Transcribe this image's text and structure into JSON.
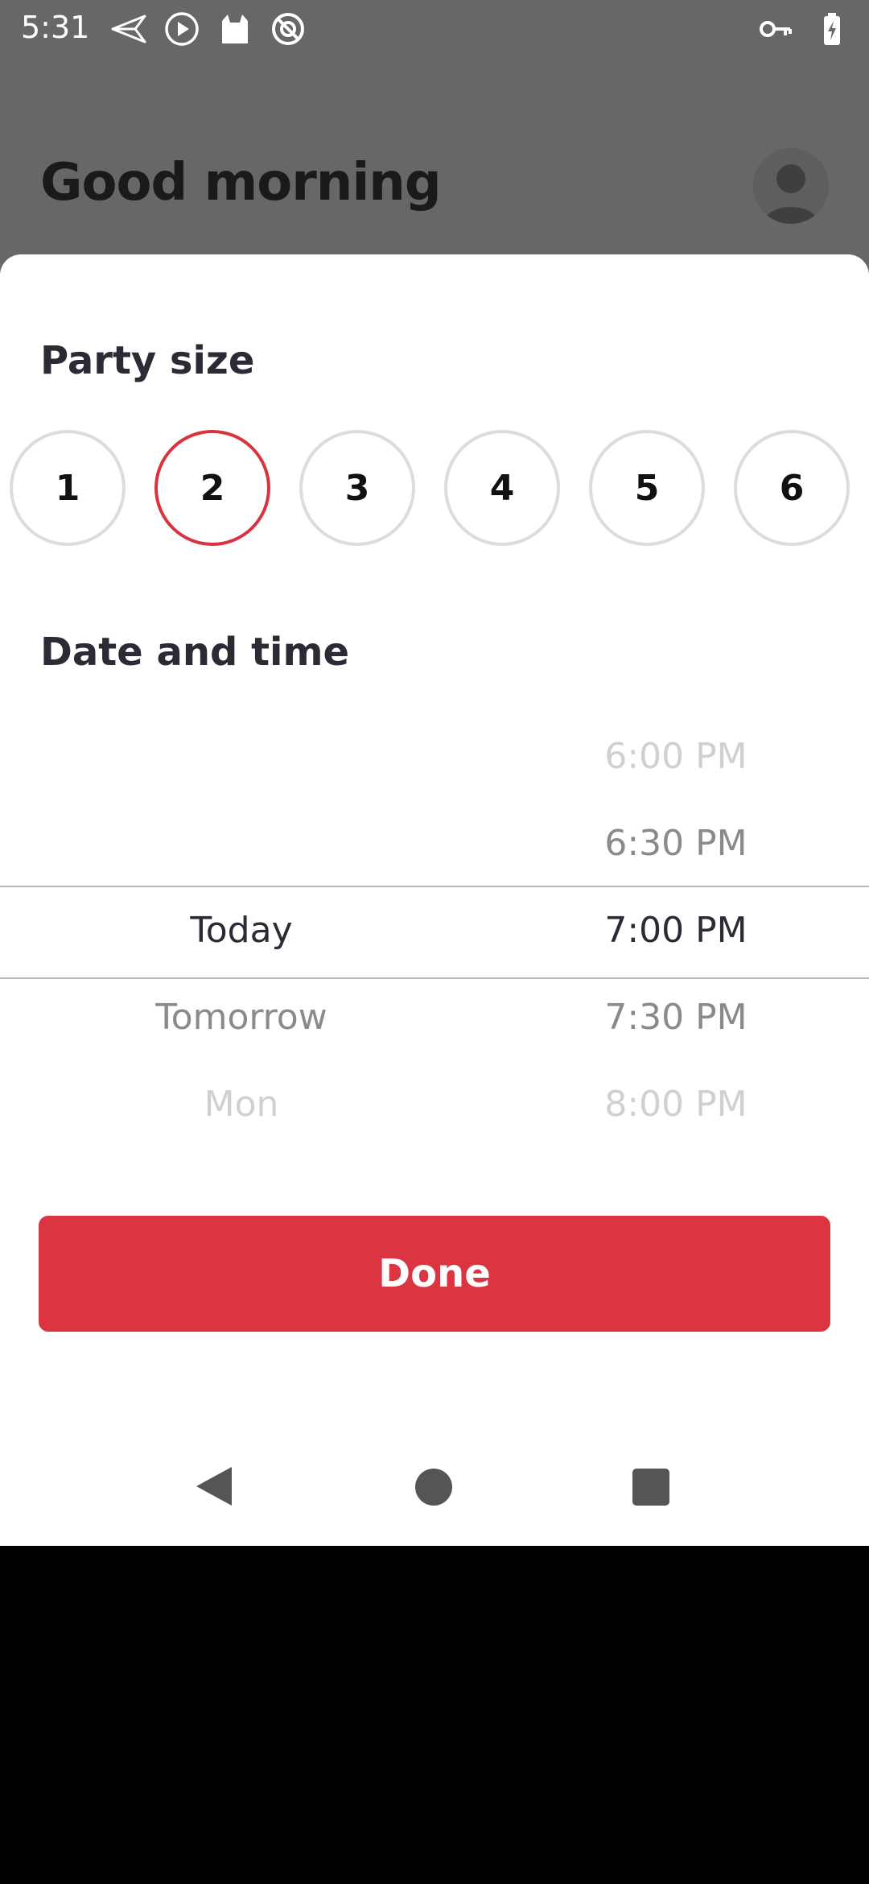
{
  "status_bar": {
    "time": "5:31",
    "left_icons": [
      "send-icon",
      "play-icon",
      "cat-icon",
      "no-circle-icon"
    ],
    "right_icons": [
      "key-icon",
      "battery-charging-icon"
    ]
  },
  "background_app": {
    "greeting": "Good morning",
    "avatar_icon": "person-icon"
  },
  "sheet": {
    "party_size": {
      "title": "Party size",
      "options": [
        "1",
        "2",
        "3",
        "4",
        "5",
        "6"
      ],
      "selected": "2"
    },
    "date_time": {
      "title": "Date and time",
      "dates": [
        "Today",
        "Tomorrow",
        "Mon"
      ],
      "times": [
        "6:00 PM",
        "6:30 PM",
        "7:00 PM",
        "7:30 PM",
        "8:00 PM"
      ],
      "selected_date": "Today",
      "selected_time": "7:00 PM"
    },
    "done_label": "Done"
  },
  "colors": {
    "accent": "#da3541",
    "selected_ring": "#d8343f",
    "text_primary": "#2a2b35",
    "scrim": "#676767"
  },
  "nav_bar": {
    "icons": [
      "back-icon",
      "home-icon",
      "recents-icon"
    ]
  }
}
